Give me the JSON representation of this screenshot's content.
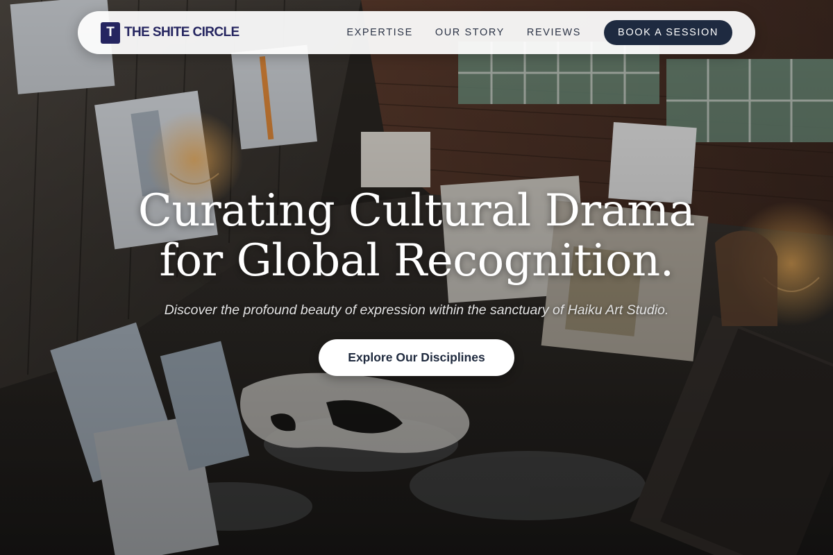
{
  "brand": {
    "mark": "T",
    "name": "THE SHITE CIRCLE"
  },
  "nav": {
    "links": [
      "EXPERTISE",
      "OUR STORY",
      "REVIEWS"
    ],
    "cta_label": "BOOK A SESSION"
  },
  "hero": {
    "title_line_1": "Curating Cultural Drama",
    "title_line_2": "for Global Recognition.",
    "subtitle": "Discover the profound beauty of expression within the sanctuary of Haiku Art Studio.",
    "cta_label": "Explore Our Disciplines"
  },
  "colors": {
    "brand_navy": "#252560",
    "nav_cta_bg": "#1e2a40",
    "nav_bg": "#ffffff",
    "hero_text": "#ffffff"
  },
  "icons": {
    "brand_logo": "letter-t-logo-icon"
  }
}
